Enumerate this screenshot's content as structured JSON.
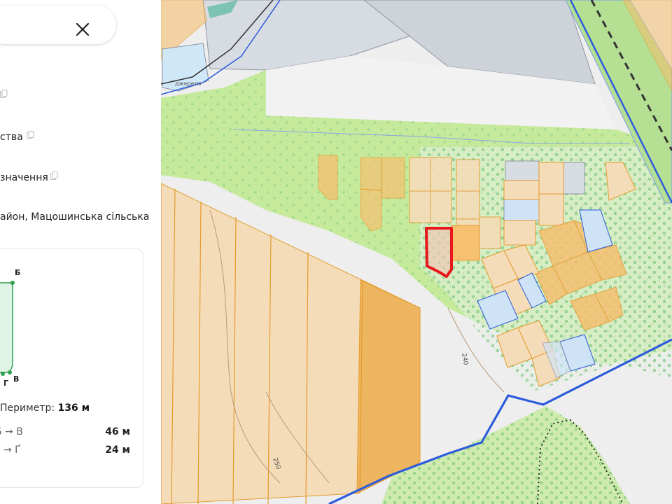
{
  "search": {
    "close_icon": "close-icon"
  },
  "info": {
    "rows": [
      {
        "text": "ства",
        "icon": "copy-icon"
      },
      {
        "text": "значення",
        "icon": "copy-icon"
      },
      {
        "text": "айон, Мацошинська сільська"
      }
    ]
  },
  "plot_card": {
    "vertices": [
      "Б",
      "Г",
      "В"
    ],
    "perimeter_label": "Периметр:",
    "perimeter_value": "136 м",
    "segments": [
      {
        "label": "Б → В",
        "value": "46 м"
      },
      {
        "label": "→ Ґ",
        "value": "24 м"
      }
    ]
  },
  "map": {
    "labels": {
      "water": "джерело",
      "contour_240": "240",
      "contour_250": "250"
    },
    "colors": {
      "selected_parcel": "#e8171b",
      "boundary_line": "#2c5bdc",
      "green_zone": "#b8e58c",
      "parcel_orange": "#f5c070",
      "industrial_gray": "#c9ced6"
    }
  }
}
